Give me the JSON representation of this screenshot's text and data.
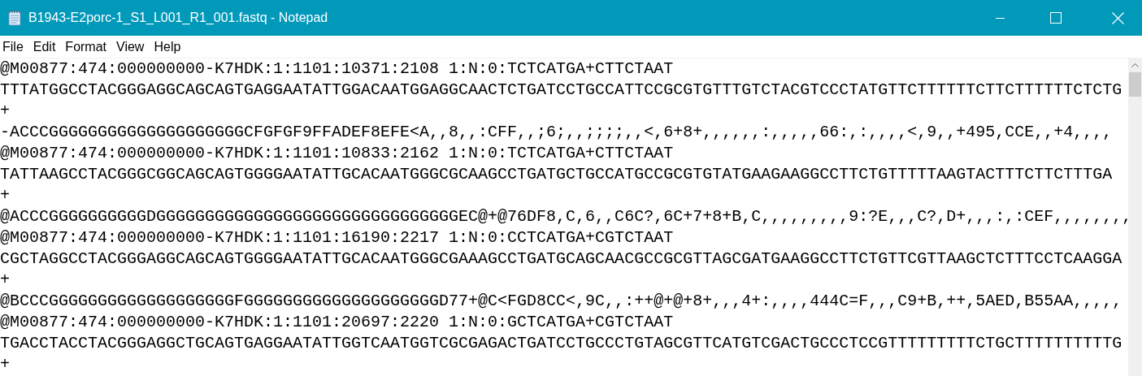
{
  "window": {
    "title": "B1943-E2porc-1_S1_L001_R1_001.fastq - Notepad"
  },
  "menu": [
    "File",
    "Edit",
    "Format",
    "View",
    "Help"
  ],
  "lines": [
    "@M00877:474:000000000-K7HDK:1:1101:10371:2108 1:N:0:TCTCATGA+CTTCTAAT",
    "TTTATGGCCTACGGGAGGCAGCAGTGAGGAATATTGGACAATGGAGGCAACTCTGATCCTGCCATTCCGCGTGTTTGTCTACGTCCCTATGTTCTTTTTTCTTCTTTTTTCTCTG",
    "+",
    "-ACCCGGGGGGGGGGGGGGGGGGGGCFGFGF9FFADEF8EFE<A,,8,,:CFF,,;6;,,;;;;,,<,6+8+,,,,,,:,,,,,66:,:,,,,<,9,,+495,CCE,,+4,,,,",
    "@M00877:474:000000000-K7HDK:1:1101:10833:2162 1:N:0:TCTCATGA+CTTCTAAT",
    "TATTAAGCCTACGGGCGGCAGCAGTGGGGAATATTGCACAATGGGCGCAAGCCTGATGCTGCCATGCCGCGTGTATGAAGAAGGCCTTCTGTTTTTAAGTACTTTCTTCTTTGA",
    "+",
    "@ACCCGGGGGGGGGGDGGGGGGGGGGGGGGGGGGGGGGGGGGGGGGGEC@+@76DF8,C,6,,C6C?,6C+7+8+B,C,,,,,,,,,9:?E,,,C?,D+,,,:,:CEF,,,,,,,,",
    "@M00877:474:000000000-K7HDK:1:1101:16190:2217 1:N:0:CCTCATGA+CGTCTAAT",
    "CGCTAGGCCTACGGGAGGCAGCAGTGGGGAATATTGCACAATGGGCGAAAGCCTGATGCAGCAACGCCGCGTTAGCGATGAAGGCCTTCTGTTCGTTAAGCTCTTTCCTCAAGGA",
    "+",
    "@BCCCGGGGGGGGGGGGGGGGGGGFGGGGGGGGGGGGGGGGGGGGD77+@C<FGD8CC<,9C,,:++@+@+8+,,,4+:,,,,444C=F,,,C9+B,++,5AED,B55AA,,,,,",
    "@M00877:474:000000000-K7HDK:1:1101:20697:2220 1:N:0:GCTCATGA+CGTCTAAT",
    "TGACCTACCTACGGGAGGCTGCAGTGAGGAATATTGGTCAATGGTCGCGAGACTGATCCTGCCCTGTAGCGTTCATGTCGACTGCCCTCCGTTTTTTTTTCTGCTTTTTTTTTTG",
    "+"
  ]
}
